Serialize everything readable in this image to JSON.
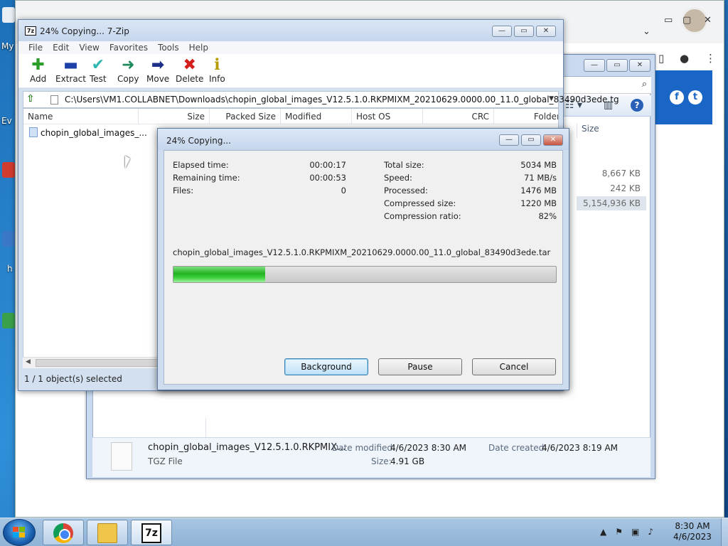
{
  "desktop": {
    "labels": [
      "My",
      "Ev",
      "h"
    ]
  },
  "explorer": {
    "size_header": "Size",
    "sizes": [
      "8,667 KB",
      "242 KB",
      "5,154,936 KB"
    ],
    "details": {
      "name": "chopin_global_images_V12.5.1.0.RKPMIX...",
      "type": "TGZ File",
      "date_modified_label": "Date modified:",
      "date_modified": "4/6/2023 8:30 AM",
      "date_created_label": "Date created:",
      "date_created": "4/6/2023 8:19 AM",
      "size_label": "Size:",
      "size": "4.91 GB"
    }
  },
  "zip": {
    "title": "24% Copying... 7-Zip",
    "app_icon_text": "7z",
    "menu": [
      "File",
      "Edit",
      "View",
      "Favorites",
      "Tools",
      "Help"
    ],
    "toolbar": [
      {
        "label": "Add",
        "icon": "plus-icon",
        "color": "#2a9d2a"
      },
      {
        "label": "Extract",
        "icon": "minus-icon",
        "color": "#1c3fa8"
      },
      {
        "label": "Test",
        "icon": "check-icon",
        "color": "#2eb8b0"
      },
      {
        "label": "Copy",
        "icon": "copy-arrow-icon",
        "color": "#1f8a5a"
      },
      {
        "label": "Move",
        "icon": "move-arrow-icon",
        "color": "#1c2f8a"
      },
      {
        "label": "Delete",
        "icon": "delete-x-icon",
        "color": "#d41f1f"
      },
      {
        "label": "Info",
        "icon": "info-icon",
        "color": "#b59b00"
      }
    ],
    "path": "C:\\Users\\VM1.COLLABNET\\Downloads\\chopin_global_images_V12.5.1.0.RKPMIXM_20210629.0000.00_11.0_global_83490d3ede.tg",
    "columns": [
      "Name",
      "Size",
      "Packed Size",
      "Modified",
      "Host OS",
      "CRC",
      "Folder"
    ],
    "item": "chopin_global_images_...",
    "status": "1 / 1 object(s) selected"
  },
  "dialog": {
    "title": "24% Copying...",
    "left_stats": [
      {
        "label": "Elapsed time:",
        "value": "00:00:17"
      },
      {
        "label": "Remaining time:",
        "value": "00:00:53"
      },
      {
        "label": "Files:",
        "value": "0"
      }
    ],
    "right_stats": [
      {
        "label": "Total size:",
        "value": "5034 MB"
      },
      {
        "label": "Speed:",
        "value": "71 MB/s"
      },
      {
        "label": "Processed:",
        "value": "1476 MB"
      },
      {
        "label": "Compressed size:",
        "value": "1220 MB"
      },
      {
        "label": "Compression ratio:",
        "value": "82%"
      }
    ],
    "filename": "chopin_global_images_V12.5.1.0.RKPMIXM_20210629.0000.00_11.0_global_83490d3ede.tar",
    "progress_percent": 24,
    "buttons": {
      "background": "Background",
      "pause": "Pause",
      "cancel": "Cancel"
    }
  },
  "taskbar": {
    "zip_button_text": "7z",
    "time": "8:30 AM",
    "date": "4/6/2023"
  },
  "colors": {
    "progress_fill": "#22b222",
    "social_blue": "#1966c6"
  }
}
